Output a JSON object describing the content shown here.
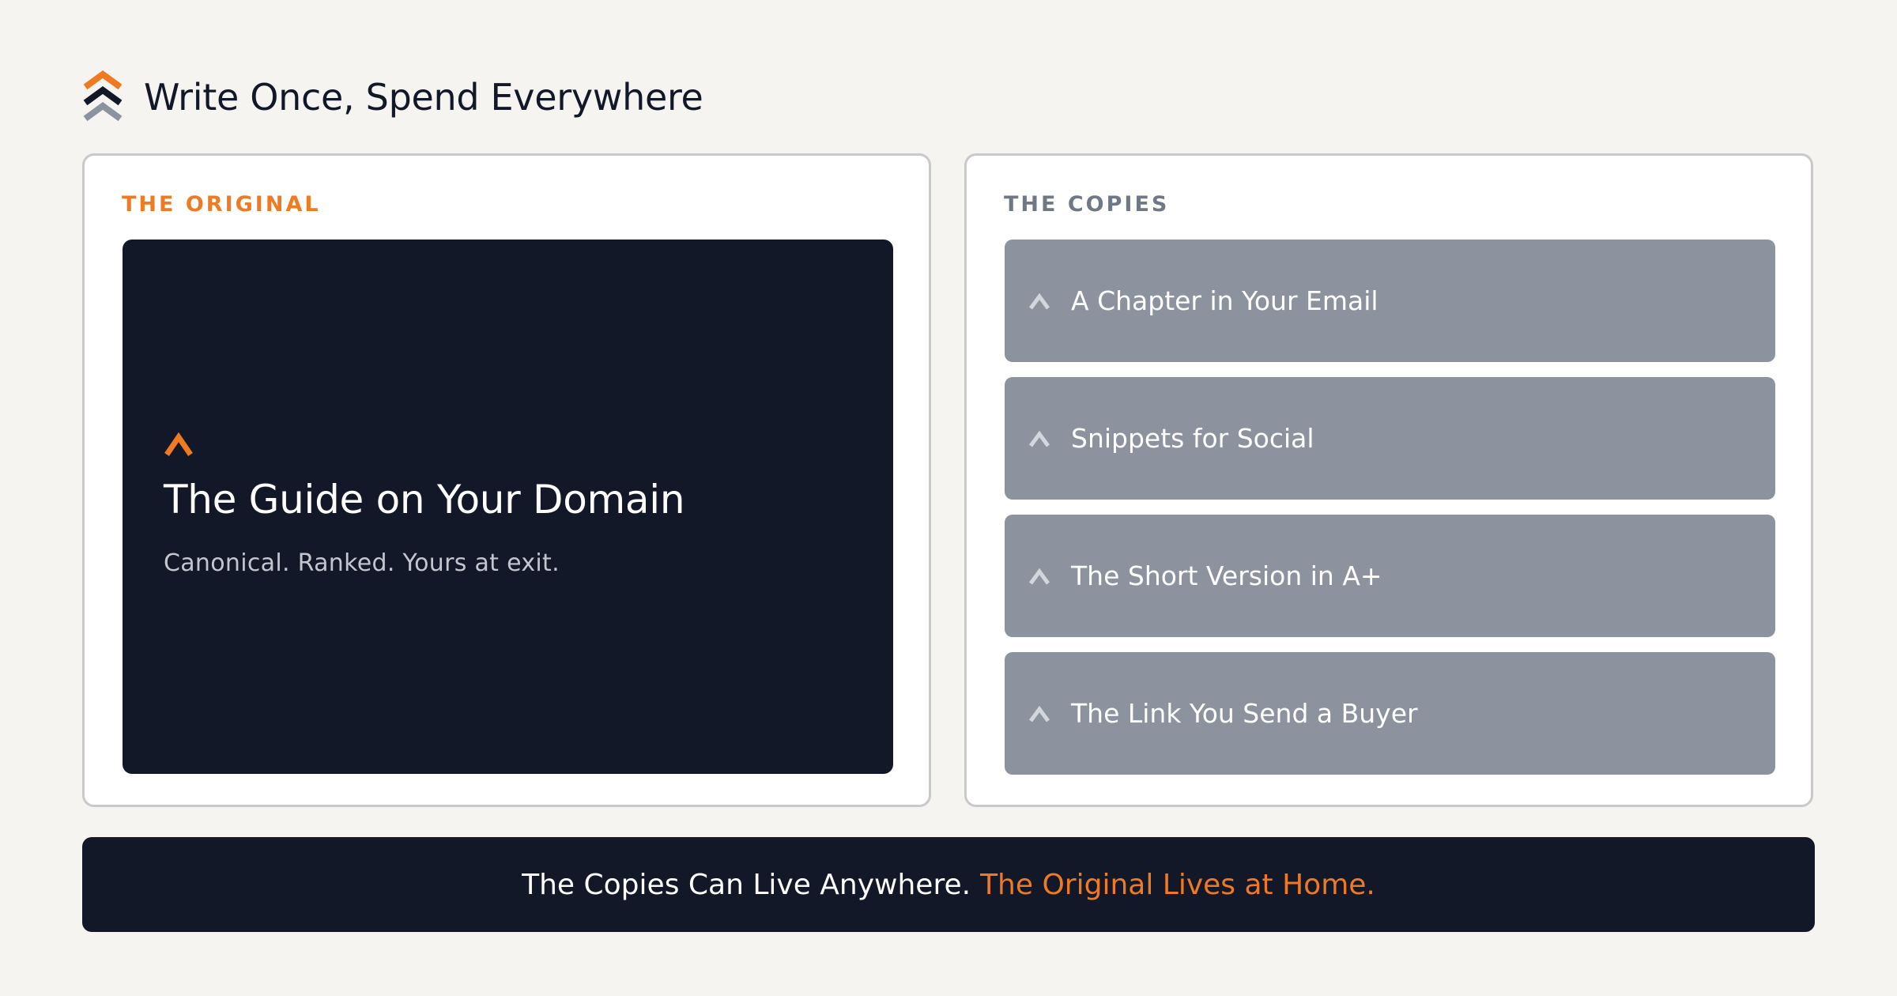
{
  "header": {
    "title": "Write Once, Spend Everywhere",
    "logo_icon": "stacked-chevrons-icon"
  },
  "original": {
    "label": "THE ORIGINAL",
    "card_icon": "chevron-up-icon",
    "title": "The Guide on Your Domain",
    "subtitle": "Canonical. Ranked. Yours at exit."
  },
  "copies": {
    "label": "THE COPIES",
    "item_icon": "chevron-up-icon",
    "items": [
      {
        "label": "A Chapter in Your Email"
      },
      {
        "label": "Snippets for Social"
      },
      {
        "label": "The Short Version in A+"
      },
      {
        "label": "The Link You Send a Buyer"
      }
    ]
  },
  "banner": {
    "text_main": "The Copies Can Live Anywhere.",
    "text_accent": "The Original Lives at Home."
  },
  "colors": {
    "background": "#f5f4f1",
    "navy": "#131828",
    "accent_orange": "#ef7a22",
    "copy_gray": "#8d939e",
    "label_gray": "#717885"
  }
}
